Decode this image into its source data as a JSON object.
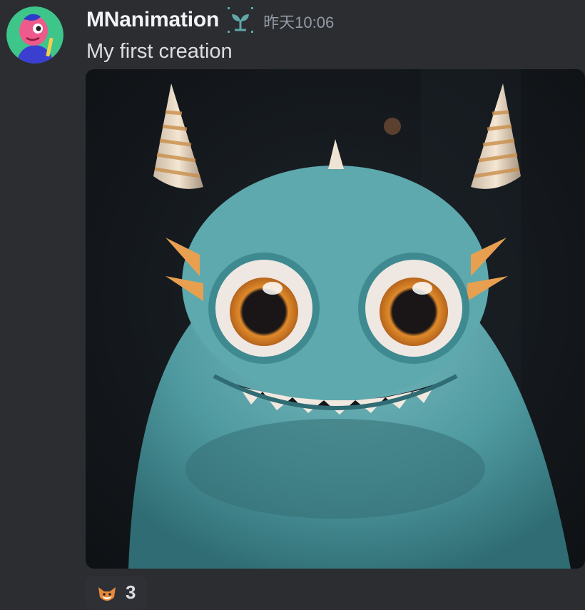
{
  "message": {
    "author": "MNanimation",
    "badge_icon": "sprout-badge-icon",
    "timestamp": "昨天10:06",
    "content": "My first creation",
    "attachment": {
      "type": "image",
      "subject": "furry-teal-monster"
    },
    "reactions": [
      {
        "emoji": "fox-emoji-icon",
        "count": "3"
      }
    ]
  },
  "colors": {
    "background": "#2b2d31",
    "username": "#f2f3f5",
    "timestamp": "#949ba4",
    "text": "#dbdee1",
    "badge": "#5fa7a8",
    "avatar_bg": "#3ec58a"
  }
}
